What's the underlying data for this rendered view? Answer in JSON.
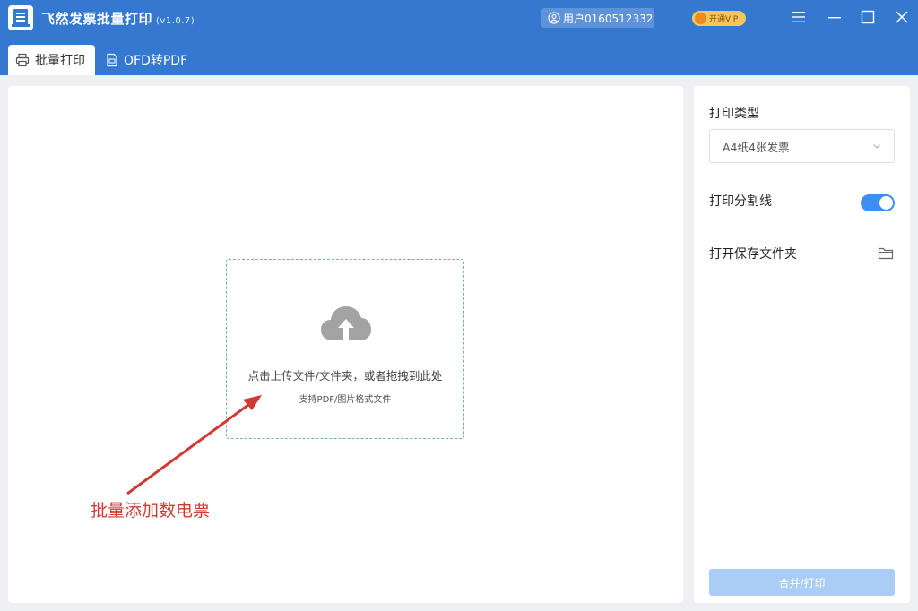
{
  "app": {
    "title": "飞然发票批量打印",
    "version": "(v1.0.7)",
    "logo_icon": "invoice-logo-icon"
  },
  "header": {
    "user_label": "用户0160512332",
    "vip_label": "开通VIP",
    "window_controls": [
      "menu-icon",
      "minimize-icon",
      "maximize-icon",
      "close-icon"
    ]
  },
  "tabs": [
    {
      "label": "批量打印",
      "icon": "printer-icon",
      "active": true
    },
    {
      "label": "OFD转PDF",
      "icon": "document-icon",
      "active": false
    }
  ],
  "upload": {
    "main_text": "点击上传文件/文件夹，或者拖拽到此处",
    "sub_text": "支持PDF/图片格式文件",
    "icon": "cloud-upload-icon"
  },
  "annotation": {
    "text": "批量添加数电票",
    "color": "#d03a33"
  },
  "settings": {
    "print_type_label": "打印类型",
    "print_type_value": "A4纸4张发票",
    "divider_label": "打印分割线",
    "divider_enabled": true,
    "open_folder_label": "打开保存文件夹",
    "print_button": "合并/打印"
  },
  "colors": {
    "primary": "#3478d0",
    "toggle_on": "#3d8ef3",
    "button_disabled": "#a9cdf4"
  }
}
